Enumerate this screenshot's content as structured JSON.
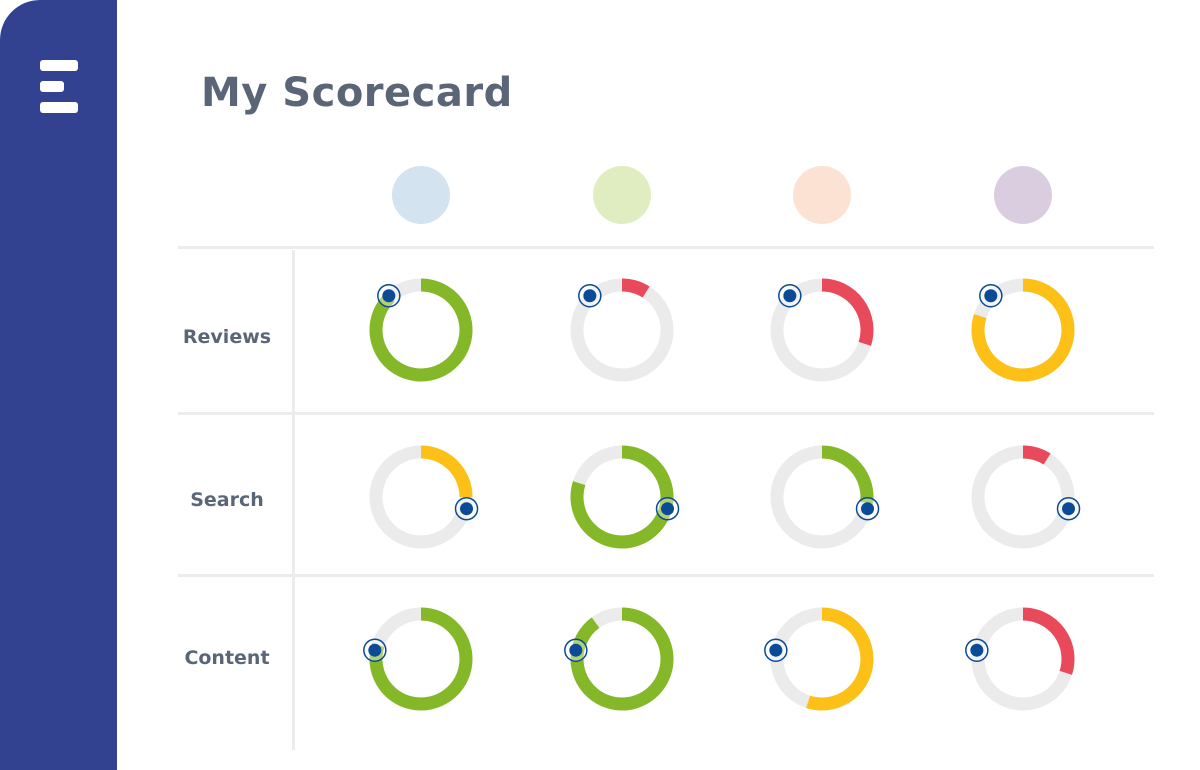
{
  "page_title": "My Scorecard",
  "colors": {
    "sidebar": "#334290",
    "good": "#84b828",
    "warn": "#fdc017",
    "bad": "#e84a5c",
    "track": "#ebebeb",
    "marker": "#0a4a96"
  },
  "columns": [
    {
      "color": "#d4e3f0"
    },
    {
      "color": "#e0edc0"
    },
    {
      "color": "#fbe2d3"
    },
    {
      "color": "#dacde0"
    }
  ],
  "rows": [
    {
      "label": "Reviews",
      "marker": 0.88,
      "cells": [
        {
          "value": 0.88,
          "status": "good"
        },
        {
          "value": 0.09,
          "status": "bad"
        },
        {
          "value": 0.3,
          "status": "bad"
        },
        {
          "value": 0.8,
          "status": "warn"
        }
      ]
    },
    {
      "label": "Search",
      "marker": 0.29,
      "cells": [
        {
          "value": 0.25,
          "status": "warn"
        },
        {
          "value": 0.8,
          "status": "good"
        },
        {
          "value": 0.27,
          "status": "good"
        },
        {
          "value": 0.09,
          "status": "bad"
        }
      ]
    },
    {
      "label": "Content",
      "marker": 0.78,
      "cells": [
        {
          "value": 0.8,
          "status": "good"
        },
        {
          "value": 0.9,
          "status": "good"
        },
        {
          "value": 0.55,
          "status": "warn"
        },
        {
          "value": 0.3,
          "status": "bad"
        }
      ]
    }
  ]
}
